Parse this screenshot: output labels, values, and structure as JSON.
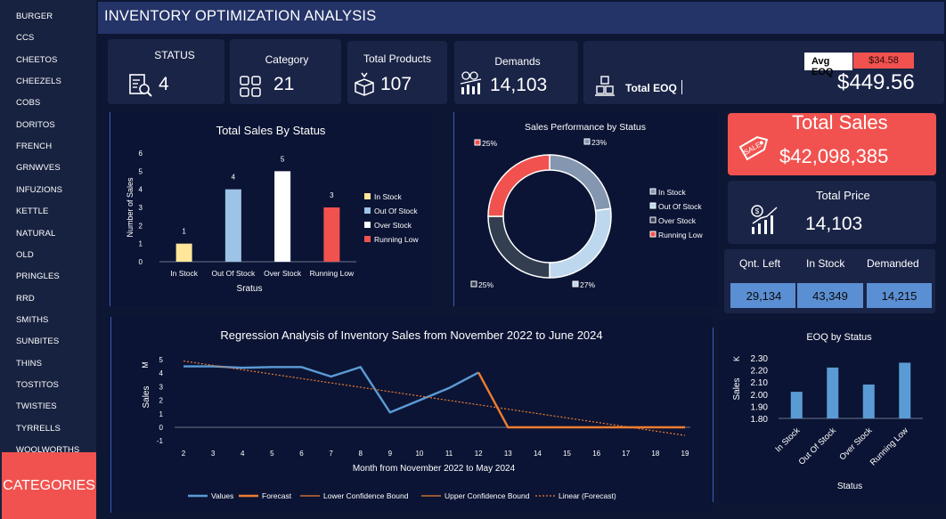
{
  "sidebar": {
    "items": [
      "BURGER",
      "CCS",
      "CHEETOS",
      "CHEEZELS",
      "COBS",
      "DORITOS",
      "FRENCH",
      "GRNWVES",
      "INFUZIONS",
      "KETTLE",
      "NATURAL",
      "OLD",
      "PRINGLES",
      "RRD",
      "SMITHS",
      "SUNBITES",
      "THINS",
      "TOSTITOS",
      "TWISTIES",
      "TYRRELLS",
      "WOOLWORTHS"
    ],
    "categories_button": "CATEGORIES"
  },
  "header": {
    "title": "INVENTORY OPTIMIZATION ANALYSIS"
  },
  "kpis": {
    "status": {
      "label": "STATUS",
      "value": "4"
    },
    "category": {
      "label": "Category",
      "value": "21"
    },
    "total_products": {
      "label": "Total Products",
      "value": "107"
    },
    "demands": {
      "label": "Demands",
      "value": "14,103"
    },
    "eoq": {
      "avg_label": "Avg EOQ",
      "avg_value": "$34.58",
      "total_label": "Total EOQ",
      "total_value": "$449.56"
    }
  },
  "total_sales": {
    "label": "Total Sales",
    "value": "$42,098,385"
  },
  "total_price": {
    "label": "Total Price",
    "value": "14,103"
  },
  "quantities": {
    "headers": [
      "Qnt. Left",
      "In Stock",
      "Demanded"
    ],
    "values": [
      "29,134",
      "43,349",
      "14,215"
    ]
  },
  "colors": {
    "accent_red": "#f1524f",
    "bar_blue": "#5b8fd3",
    "panel": "#1a2447",
    "in_stock": "#ffe699",
    "out_of_stock": "#9dc3e6",
    "over_stock": "#ffffff",
    "running_low": "#f1524f"
  },
  "chart_data": [
    {
      "type": "bar",
      "title": "Total Sales By Status",
      "xlabel": "Sratus",
      "ylabel": "Number of Sales",
      "categories": [
        "In Stock",
        "Out Of Stock",
        "Over Stock",
        "Running Low"
      ],
      "values": [
        1,
        4,
        5,
        3
      ],
      "ylim": [
        0,
        6
      ],
      "yticks": [
        "0",
        "1",
        "2",
        "3",
        "4",
        "5",
        "6"
      ],
      "legend": [
        "In Stock",
        "Out Of Stock",
        "Over Stock",
        "Running Low"
      ],
      "legend_position": "right",
      "bar_colors": [
        "#ffe699",
        "#9dc3e6",
        "#ffffff",
        "#f1524f"
      ]
    },
    {
      "type": "pie",
      "title": "Sales Performance by Status",
      "labels": [
        "In Stock",
        "Out Of Stock",
        "Over Stock",
        "Running Low"
      ],
      "values": [
        23,
        27,
        25,
        25
      ],
      "value_labels": [
        "23%",
        "27%",
        "25%",
        "25%"
      ],
      "colors": [
        "#8496b0",
        "#bdd7ee",
        "#333f50",
        "#f1524f"
      ],
      "legend_position": "right"
    },
    {
      "type": "line",
      "title": "Regression Analysis of Inventory Sales from November 2022 to June 2024",
      "xlabel": "Month from November 2022 to May 2024",
      "ylabel": "Sales",
      "yunit": "M",
      "xlim": [
        2,
        19
      ],
      "ylim": [
        -1,
        5
      ],
      "xticks": [
        "2",
        "3",
        "4",
        "5",
        "6",
        "7",
        "8",
        "9",
        "10",
        "11",
        "12",
        "13",
        "14",
        "15",
        "16",
        "17",
        "18",
        "19"
      ],
      "yticks": [
        "-1",
        "0",
        "1",
        "2",
        "3",
        "4",
        "5"
      ],
      "series": [
        {
          "name": "Values",
          "x": [
            2,
            3,
            4,
            5,
            6,
            7,
            8,
            9,
            10,
            11,
            12
          ],
          "y": [
            4.5,
            4.5,
            4.4,
            4.45,
            4.45,
            3.75,
            4.45,
            1.1,
            2.0,
            2.9,
            4.05
          ]
        },
        {
          "name": "Forecast",
          "x": [
            12,
            13,
            14,
            15,
            16,
            17,
            18,
            19
          ],
          "y": [
            4.05,
            0,
            0,
            0,
            0,
            0,
            0,
            0
          ]
        },
        {
          "name": "Lower Confidence Bound",
          "x": [
            12,
            13,
            14,
            15,
            16,
            17,
            18,
            19
          ],
          "y": [
            4.05,
            0,
            0,
            0,
            0,
            0,
            0,
            0
          ]
        },
        {
          "name": "Upper Confidence Bound",
          "x": [
            12,
            13,
            14,
            15,
            16,
            17,
            18,
            19
          ],
          "y": [
            4.05,
            0,
            0,
            0,
            0,
            0,
            0,
            0
          ]
        },
        {
          "name": "Linear (Forecast)",
          "x": [
            2,
            19
          ],
          "y": [
            4.9,
            -0.6
          ]
        }
      ],
      "legend_position": "bottom"
    },
    {
      "type": "bar",
      "title": "EOQ by Status",
      "xlabel": "Status",
      "ylabel": "Sales",
      "yunit": "K",
      "categories": [
        "In Stock",
        "Out Of Stock",
        "Over Stock",
        "Running Low"
      ],
      "values": [
        2.02,
        2.22,
        2.08,
        2.26
      ],
      "ylim": [
        1.8,
        2.3
      ],
      "yticks": [
        "1.80",
        "1.90",
        "2.00",
        "2.10",
        "2.20",
        "2.30"
      ]
    }
  ]
}
